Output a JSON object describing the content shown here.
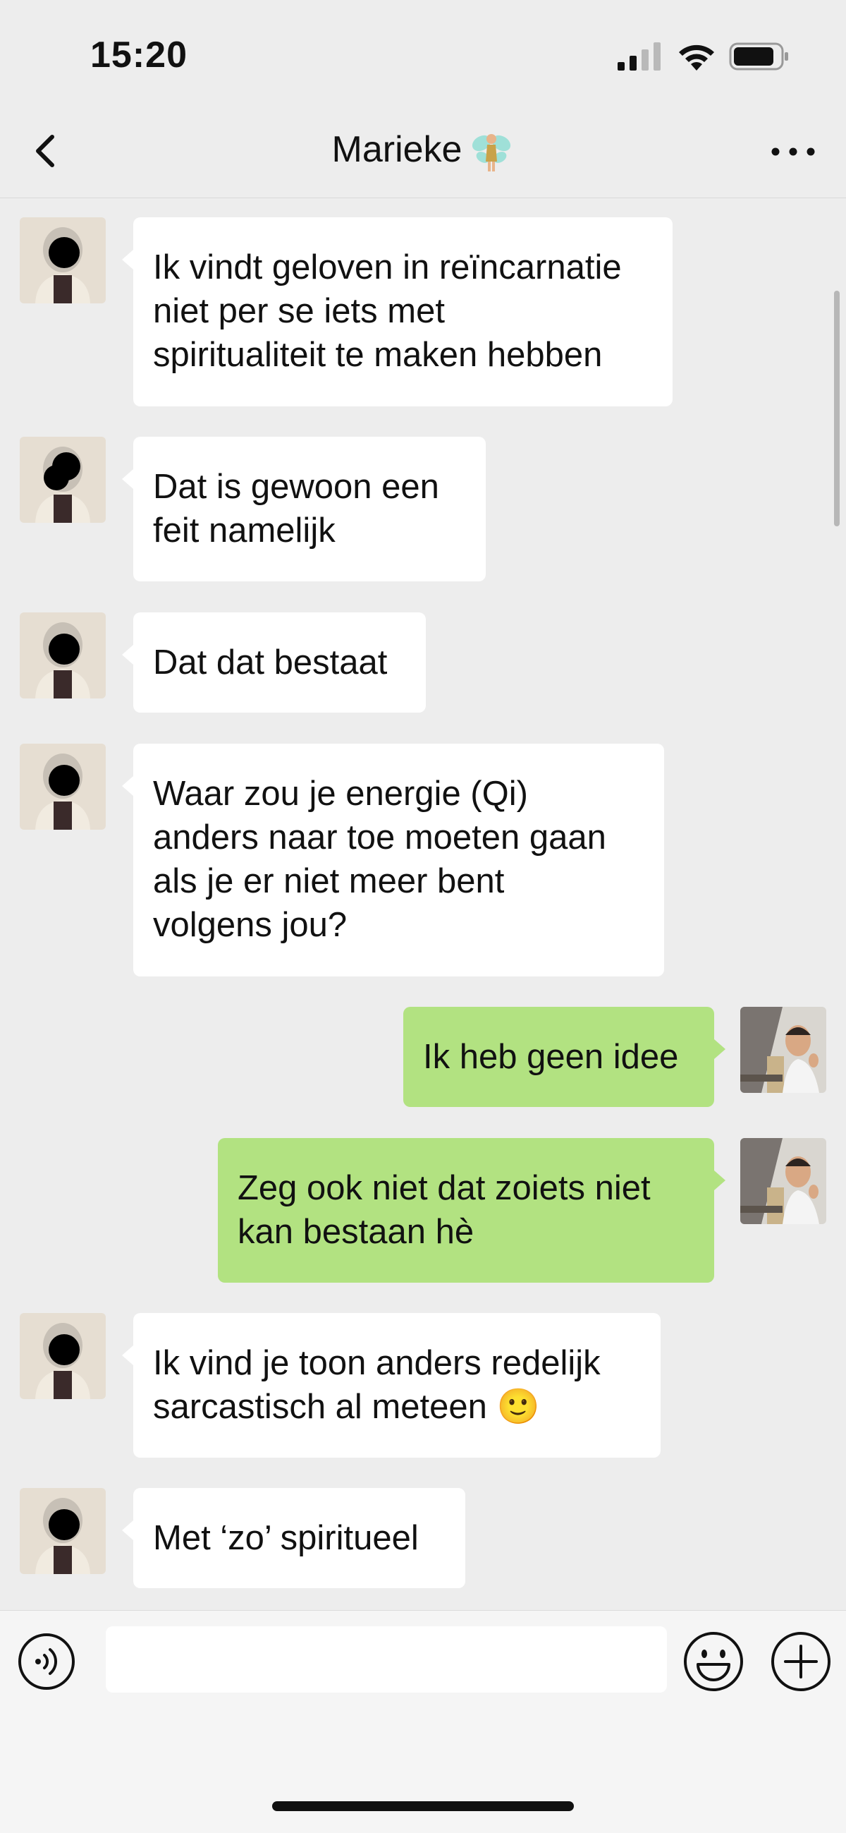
{
  "status_bar": {
    "time": "15:20",
    "icons": [
      "cellular-signal-icon",
      "wifi-icon",
      "battery-icon"
    ]
  },
  "nav": {
    "back_icon": "chevron-left-icon",
    "title": "Marieke",
    "title_emoji": "fairy-emoji",
    "more_icon": "more-icon"
  },
  "messages": [
    {
      "from": "contact",
      "text": "Ik vindt geloven in reïncarnatie\nniet per se iets met\nspiritualiteit te maken hebben"
    },
    {
      "from": "contact",
      "text": "Dat is gewoon een\nfeit namelijk"
    },
    {
      "from": "contact",
      "text": "Dat dat bestaat"
    },
    {
      "from": "contact",
      "text": "Waar zou je energie (Qi)\nanders naar toe moeten gaan\nals je er niet meer bent\nvolgens jou?"
    },
    {
      "from": "me",
      "text": "Ik heb geen idee"
    },
    {
      "from": "me",
      "text": "Zeg ook niet dat zoiets niet\nkan bestaan hè"
    },
    {
      "from": "contact",
      "text": "Ik vind je toon anders redelijk\nsarcastisch al meteen 🙂"
    },
    {
      "from": "contact",
      "text": "Met ‘zo’ spiritueel"
    }
  ],
  "input_bar": {
    "voice_icon": "voice-icon",
    "emoji_icon": "emoji-icon",
    "plus_icon": "plus-icon",
    "value": ""
  },
  "colors": {
    "background": "#ededed",
    "incoming_bubble": "#ffffff",
    "outgoing_bubble": "#b2e281"
  }
}
